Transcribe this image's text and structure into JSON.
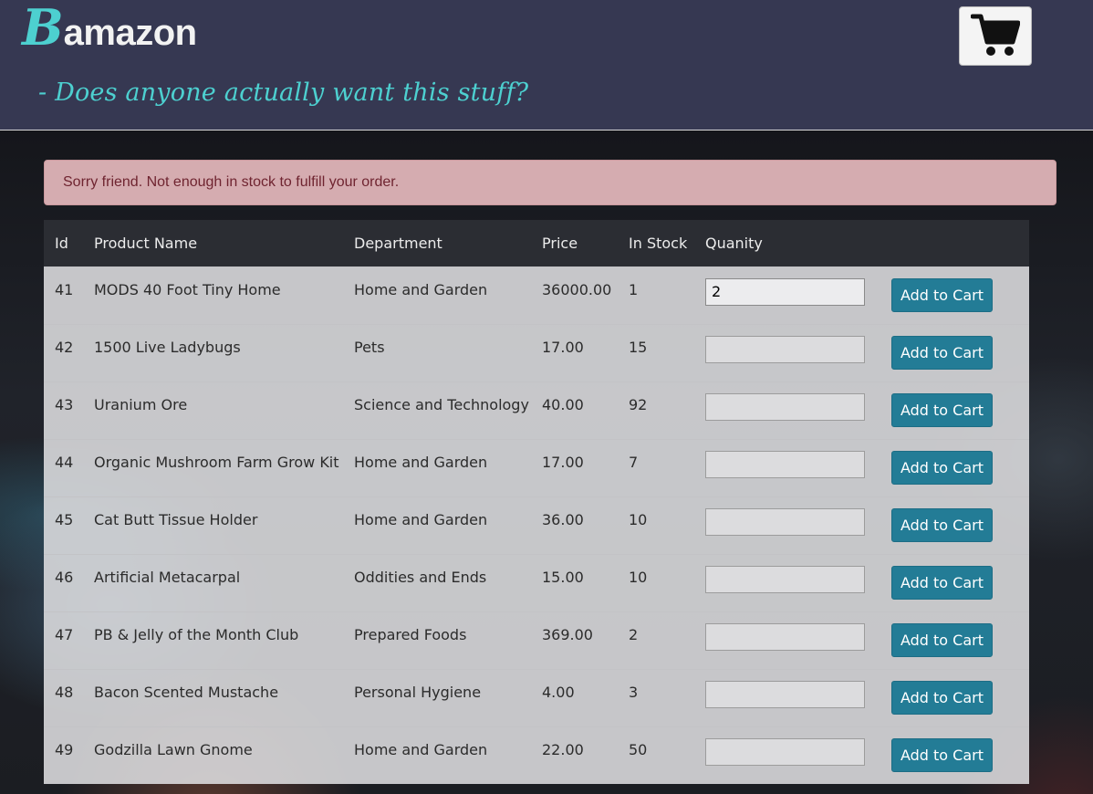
{
  "header": {
    "logo_initial": "B",
    "logo_rest": "amazon",
    "tagline": "- Does anyone actually want this stuff?",
    "cart_icon": "shopping-cart-icon"
  },
  "alert": {
    "message": "Sorry friend. Not enough in stock to fulfill your order."
  },
  "table": {
    "columns": [
      "Id",
      "Product Name",
      "Department",
      "Price",
      "In Stock",
      "Quanity",
      ""
    ],
    "add_label": "Add to Cart",
    "rows": [
      {
        "id": "41",
        "name": "MODS 40 Foot Tiny Home",
        "department": "Home and Garden",
        "price": "36000.00",
        "stock": "1",
        "qty": "2"
      },
      {
        "id": "42",
        "name": "1500 Live Ladybugs",
        "department": "Pets",
        "price": "17.00",
        "stock": "15",
        "qty": ""
      },
      {
        "id": "43",
        "name": "Uranium Ore",
        "department": "Science and Technology",
        "price": "40.00",
        "stock": "92",
        "qty": ""
      },
      {
        "id": "44",
        "name": "Organic Mushroom Farm Grow Kit",
        "department": "Home and Garden",
        "price": "17.00",
        "stock": "7",
        "qty": ""
      },
      {
        "id": "45",
        "name": "Cat Butt Tissue Holder",
        "department": "Home and Garden",
        "price": "36.00",
        "stock": "10",
        "qty": ""
      },
      {
        "id": "46",
        "name": "Artificial Metacarpal",
        "department": "Oddities and Ends",
        "price": "15.00",
        "stock": "10",
        "qty": ""
      },
      {
        "id": "47",
        "name": "PB & Jelly of the Month Club",
        "department": "Prepared Foods",
        "price": "369.00",
        "stock": "2",
        "qty": ""
      },
      {
        "id": "48",
        "name": "Bacon Scented Mustache",
        "department": "Personal Hygiene",
        "price": "4.00",
        "stock": "3",
        "qty": ""
      },
      {
        "id": "49",
        "name": "Godzilla Lawn Gnome",
        "department": "Home and Garden",
        "price": "22.00",
        "stock": "50",
        "qty": ""
      }
    ]
  },
  "colors": {
    "header_bg": "#363852",
    "accent_teal": "#4dd0d0",
    "button_blue": "#237c96",
    "alert_bg": "#d5acb0"
  }
}
